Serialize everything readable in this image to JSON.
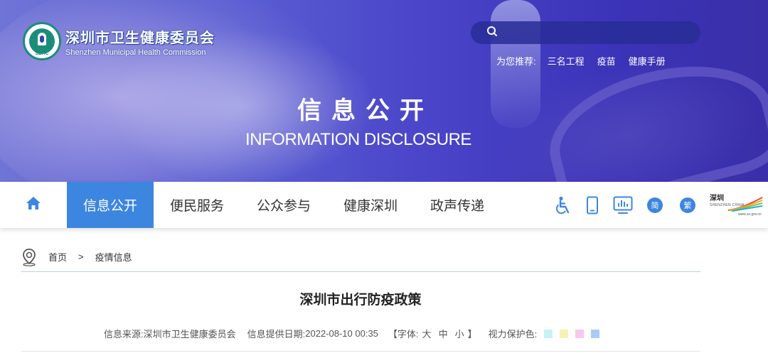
{
  "header": {
    "logo_cn": "深圳市卫生健康委员会",
    "logo_en": "Shenzhen Municipal Health Commission",
    "logo_badge": "SZHC",
    "search_placeholder": "",
    "recommend_lead": "为您推荐:",
    "recommend_links": [
      "三名工程",
      "疫苗",
      "健康手册"
    ],
    "banner_title_cn": "信息公开",
    "banner_title_en": "INFORMATION DISCLOSURE"
  },
  "nav": {
    "items": [
      "信息公开",
      "便民服务",
      "公众参与",
      "健康深圳",
      "政声传递"
    ],
    "active_index": 0,
    "tools": {
      "simplified": "简",
      "traditional": "繁"
    },
    "sz_logo": {
      "cn": "深圳",
      "en": "SHENZHEN CHINA",
      "url": "www.sz.gov.cn"
    }
  },
  "breadcrumb": {
    "home": "首页",
    "separator": ">",
    "current": "疫情信息"
  },
  "article": {
    "title": "深圳市出行防疫政策",
    "source_label": "信息来源:",
    "source": "深圳市卫生健康委员会",
    "date_label": "信息提供日期:",
    "date": "2022-08-10 00:35",
    "font_open": "【字体:",
    "font_large": "大",
    "font_medium": "中",
    "font_small": "小",
    "font_close": "】",
    "eye_label": "视力保护色:",
    "eye_colors": [
      "#c9f1f4",
      "#f7f2b4",
      "#f4c8ef",
      "#a9ccf4"
    ]
  },
  "colors": {
    "accent": "#3d86e0",
    "banner": "#4a45c9"
  }
}
